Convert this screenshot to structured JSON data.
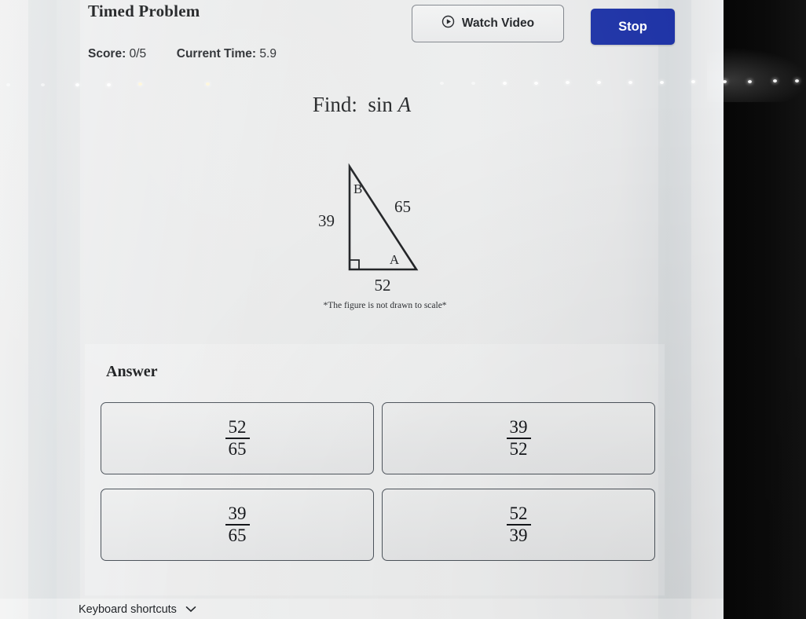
{
  "header": {
    "title": "Timed Problem",
    "score_label": "Score:",
    "score_value": "0/5",
    "time_label": "Current Time:",
    "time_value": "5.9",
    "watch_video_label": "Watch Video",
    "stop_label": "Stop",
    "stop_color": "#1e33a6"
  },
  "question": {
    "prefix": "Find:",
    "function": "sin",
    "argument": "A"
  },
  "figure": {
    "type": "right-triangle",
    "note": "*The figure is not drawn to scale*",
    "vertex_top_label": "B",
    "vertex_right_label": "A",
    "side_left_label": "39",
    "side_hypotenuse_label": "65",
    "side_bottom_label": "52",
    "right_angle_at": "bottom-left",
    "stroke_color": "#17191c"
  },
  "answer": {
    "heading": "Answer",
    "choices": [
      {
        "numerator": "52",
        "denominator": "65"
      },
      {
        "numerator": "39",
        "denominator": "52"
      },
      {
        "numerator": "39",
        "denominator": "65"
      },
      {
        "numerator": "52",
        "denominator": "39"
      }
    ]
  },
  "footer": {
    "keyboard_shortcuts_label": "Keyboard shortcuts"
  }
}
